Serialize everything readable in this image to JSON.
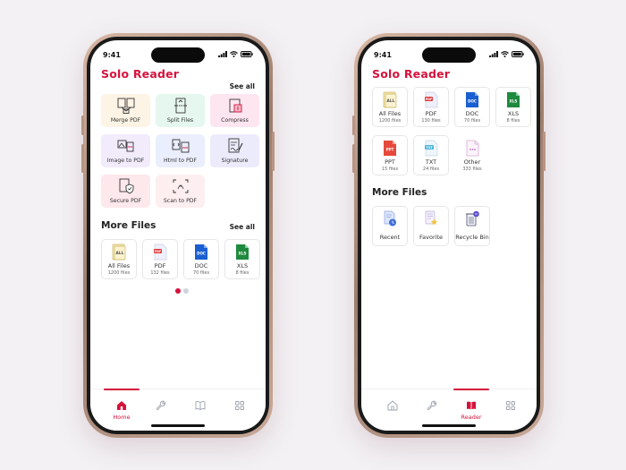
{
  "colors": {
    "accent": "#d5123c",
    "bg": "#f3f1f4"
  },
  "phone1": {
    "status_time": "9:41",
    "title": "Solo Reader",
    "tools_see_all": "See all",
    "tools": [
      {
        "label": "Merge PDF",
        "icon": "merge-pdf-icon",
        "bg": "#fdf4e6"
      },
      {
        "label": "Split Files",
        "icon": "split-files-icon",
        "bg": "#e6f7ef"
      },
      {
        "label": "Compress",
        "icon": "compress-icon",
        "bg": "#fde6ef"
      },
      {
        "label": "Image to PDF",
        "icon": "image-to-pdf-icon",
        "bg": "#f1ebfc"
      },
      {
        "label": "Html to PDF",
        "icon": "html-to-pdf-icon",
        "bg": "#ebeefc"
      },
      {
        "label": "Signature",
        "icon": "signature-icon",
        "bg": "#ecebfb"
      },
      {
        "label": "Secure PDF",
        "icon": "secure-pdf-icon",
        "bg": "#fde8ec"
      },
      {
        "label": "Scan to PDF",
        "icon": "scan-to-pdf-icon",
        "bg": "#fdeef0"
      }
    ],
    "more_files_title": "More Files",
    "more_files_see_all": "See all",
    "files": [
      {
        "name": "All Files",
        "count": "1200 files",
        "icon": "all-files-icon"
      },
      {
        "name": "PDF",
        "count": "132 files",
        "icon": "pdf-file-icon"
      },
      {
        "name": "DOC",
        "count": "70 files",
        "icon": "doc-file-icon"
      },
      {
        "name": "XLS",
        "count": "8 files",
        "icon": "xls-file-icon"
      }
    ],
    "tabs": [
      {
        "label": "Home",
        "icon": "home-icon",
        "active": true
      },
      {
        "label": "",
        "icon": "wrench-icon",
        "active": false
      },
      {
        "label": "",
        "icon": "book-icon",
        "active": false
      },
      {
        "label": "",
        "icon": "grid-icon",
        "active": false
      }
    ]
  },
  "phone2": {
    "status_time": "9:41",
    "title": "Solo Reader",
    "files": [
      {
        "name": "All Files",
        "count": "1200 files",
        "icon": "all-files-icon"
      },
      {
        "name": "PDF",
        "count": "130 files",
        "icon": "pdf-file-icon"
      },
      {
        "name": "DOC",
        "count": "70 files",
        "icon": "doc-file-icon"
      },
      {
        "name": "XLS",
        "count": "8 files",
        "icon": "xls-file-icon"
      },
      {
        "name": "PPT",
        "count": "15 files",
        "icon": "ppt-file-icon"
      },
      {
        "name": "TXT",
        "count": "24 files",
        "icon": "txt-file-icon"
      },
      {
        "name": "Other",
        "count": "333 files",
        "icon": "other-file-icon"
      }
    ],
    "more_files_title": "More Files",
    "more": [
      {
        "name": "Recent",
        "icon": "recent-icon"
      },
      {
        "name": "Favorite",
        "icon": "favorite-icon"
      },
      {
        "name": "Recycle Bin",
        "icon": "recycle-bin-icon"
      }
    ],
    "tabs": [
      {
        "label": "",
        "icon": "home-icon",
        "active": false
      },
      {
        "label": "",
        "icon": "wrench-icon",
        "active": false
      },
      {
        "label": "Reader",
        "icon": "book-icon",
        "active": true
      },
      {
        "label": "",
        "icon": "grid-icon",
        "active": false
      }
    ]
  }
}
